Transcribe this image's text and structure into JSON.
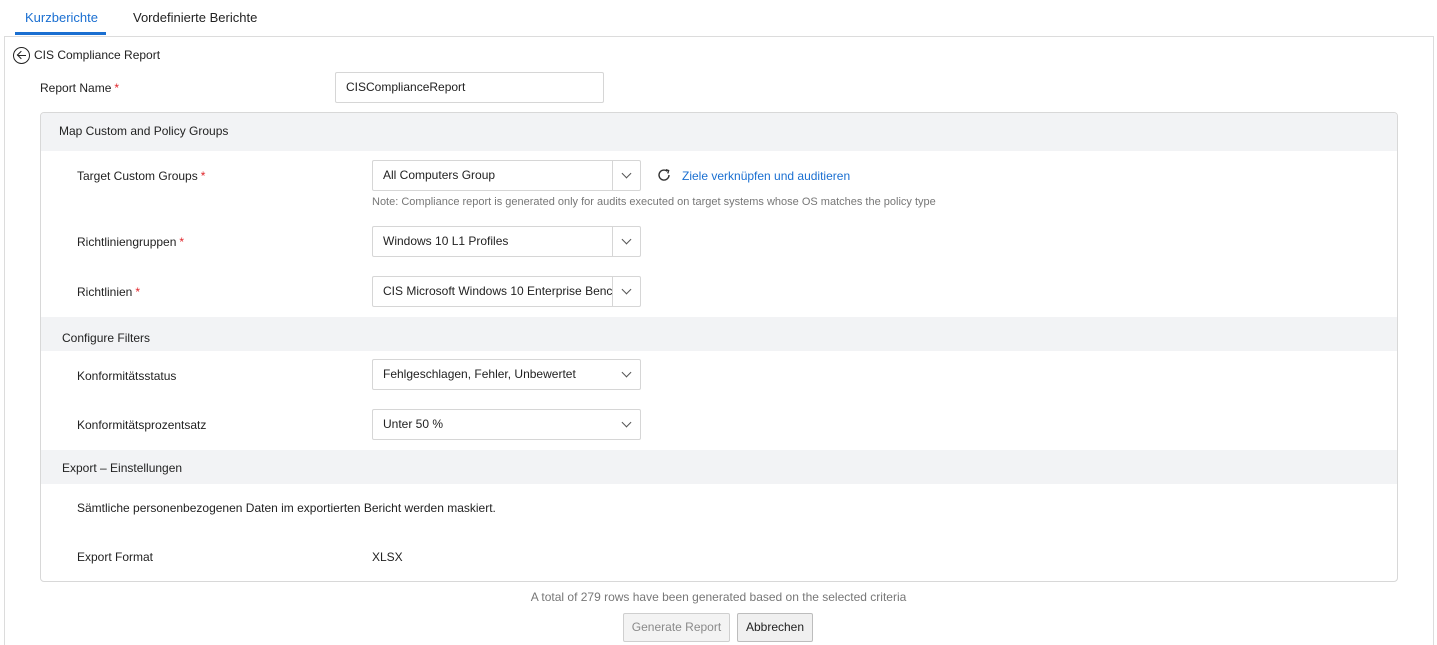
{
  "tabs": [
    {
      "label": "Kurzberichte",
      "active": true
    },
    {
      "label": "Vordefinierte Berichte",
      "active": false
    }
  ],
  "header": {
    "back_label": "CIS Compliance Report"
  },
  "report_name": {
    "label": "Report Name",
    "required": "*",
    "value": "CISComplianceReport"
  },
  "sections": {
    "map_groups": {
      "title": "Map Custom and Policy Groups",
      "target_groups": {
        "label": "Target Custom Groups",
        "value": "All Computers Group"
      },
      "link_text": "Ziele verknüpfen und auditieren",
      "note": "Note: Compliance report is generated only for audits executed on target systems whose OS matches the policy type",
      "policy_groups": {
        "label": "Richtliniengruppen",
        "value": "Windows 10 L1 Profiles"
      },
      "policies": {
        "label": "Richtlinien",
        "value": "CIS Microsoft Windows  10 Enterprise Benc ..."
      }
    },
    "filters": {
      "title": "Configure Filters",
      "status": {
        "label": "Konformitätsstatus",
        "value": "Fehlgeschlagen, Fehler, Unbewertet"
      },
      "percent": {
        "label": "Konformitätsprozentsatz",
        "value": "Unter 50 %"
      }
    },
    "export": {
      "title": "Export – Einstellungen",
      "mask_note": "Sämtliche personenbezogenen Daten im exportierten Bericht werden maskiert.",
      "format_label": "Export Format",
      "format_value": "XLSX"
    }
  },
  "footer": {
    "summary": "A total of 279 rows have been generated based on the selected criteria",
    "generate_label": "Generate Report",
    "cancel_label": "Abbrechen"
  },
  "colors": {
    "accent": "#1a6fd1",
    "required": "#e0252a",
    "band": "#f2f3f5"
  },
  "icons": [
    "back-arrow-circle-icon",
    "chevron-down-icon",
    "refresh-icon"
  ]
}
